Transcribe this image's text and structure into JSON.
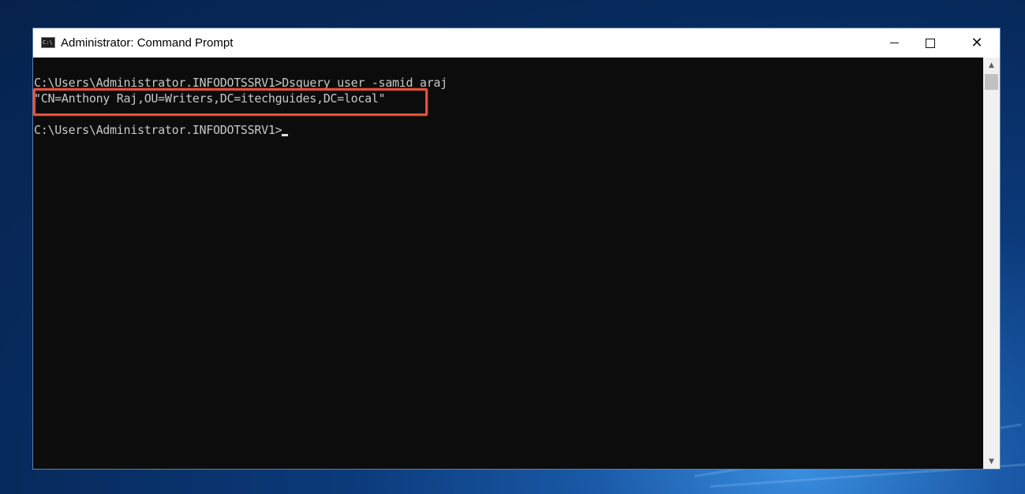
{
  "window": {
    "title": "Administrator: Command Prompt",
    "icon_text": "C:\\"
  },
  "controls": {
    "minimize_icon": "minimize-icon",
    "maximize_icon": "maximize-icon",
    "close_icon": "close-icon",
    "close_glyph": "✕"
  },
  "console": {
    "lines": [
      "C:\\Users\\Administrator.INFODOTSSRV1>Dsquery user -samid araj",
      "\"CN=Anthony Raj,OU=Writers,DC=itechguides,DC=local\"",
      "",
      "C:\\Users\\Administrator.INFODOTSSRV1>"
    ]
  },
  "scrollbar": {
    "up_glyph": "▲",
    "down_glyph": "▼"
  },
  "colors": {
    "console_bg": "#0c0c0c",
    "console_text": "#c8c8c8",
    "highlight_border": "#e6533b"
  }
}
